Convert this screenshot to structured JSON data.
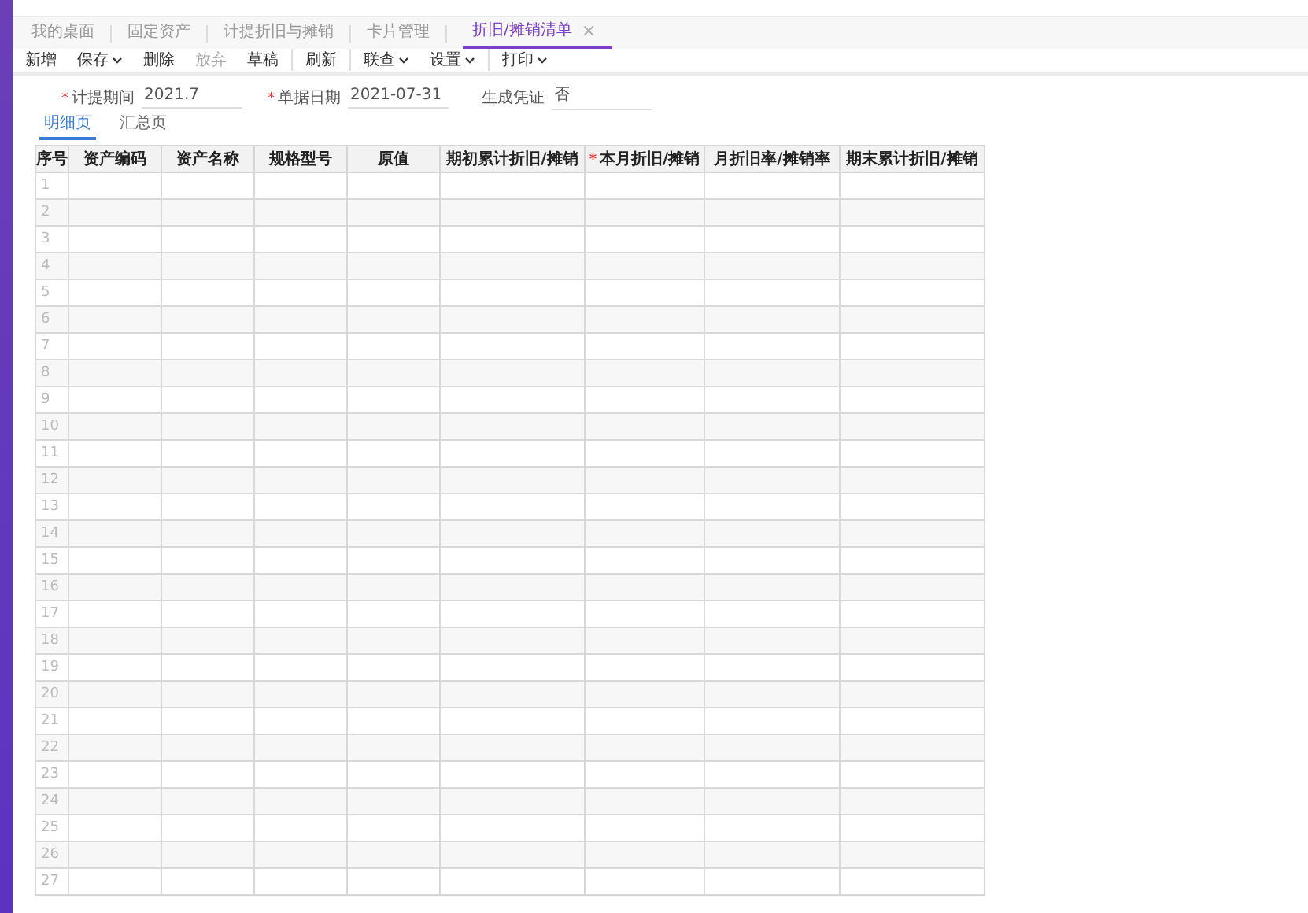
{
  "tabs": [
    {
      "label": "我的桌面",
      "selected": false,
      "closable": false
    },
    {
      "label": "固定资产",
      "selected": false,
      "closable": false
    },
    {
      "label": "计提折旧与摊销",
      "selected": false,
      "closable": false
    },
    {
      "label": "卡片管理",
      "selected": false,
      "closable": false
    },
    {
      "label": "折旧/摊销清单",
      "selected": true,
      "closable": true
    }
  ],
  "close_glyph": "×",
  "required_mark": "*",
  "toolbar": [
    {
      "label": "新增",
      "dropdown": false,
      "disabled": false,
      "divider_after": false
    },
    {
      "label": "保存",
      "dropdown": true,
      "disabled": false,
      "divider_after": false
    },
    {
      "label": "删除",
      "dropdown": false,
      "disabled": false,
      "divider_after": false
    },
    {
      "label": "放弃",
      "dropdown": false,
      "disabled": true,
      "divider_after": false
    },
    {
      "label": "草稿",
      "dropdown": false,
      "disabled": false,
      "divider_after": true
    },
    {
      "label": "刷新",
      "dropdown": false,
      "disabled": false,
      "divider_after": true
    },
    {
      "label": "联查",
      "dropdown": true,
      "disabled": false,
      "divider_after": false
    },
    {
      "label": "设置",
      "dropdown": true,
      "disabled": false,
      "divider_after": true
    },
    {
      "label": "打印",
      "dropdown": true,
      "disabled": false,
      "divider_after": false
    }
  ],
  "form": [
    {
      "label": "计提期间",
      "value": "2021.7",
      "required": true
    },
    {
      "label": "单据日期",
      "value": "2021-07-31",
      "required": true
    },
    {
      "label": "生成凭证",
      "value": "否",
      "required": false
    }
  ],
  "sub_tabs": [
    {
      "label": "明细页",
      "selected": true
    },
    {
      "label": "汇总页",
      "selected": false
    }
  ],
  "table": {
    "columns": [
      {
        "label": "序号",
        "required": false
      },
      {
        "label": "资产编码",
        "required": false
      },
      {
        "label": "资产名称",
        "required": false
      },
      {
        "label": "规格型号",
        "required": false
      },
      {
        "label": "原值",
        "required": false
      },
      {
        "label": "期初累计折旧/摊销",
        "required": false
      },
      {
        "label": "本月折旧/摊销",
        "required": true
      },
      {
        "label": "月折旧率/摊销率",
        "required": false
      },
      {
        "label": "期末累计折旧/摊销",
        "required": false
      }
    ],
    "rows": [
      "1",
      "2",
      "3",
      "4",
      "5",
      "6",
      "7",
      "8",
      "9",
      "10",
      "11",
      "12",
      "13",
      "14",
      "15",
      "16",
      "17",
      "18",
      "19",
      "20",
      "21",
      "22",
      "23",
      "24",
      "25",
      "26",
      "27"
    ]
  }
}
